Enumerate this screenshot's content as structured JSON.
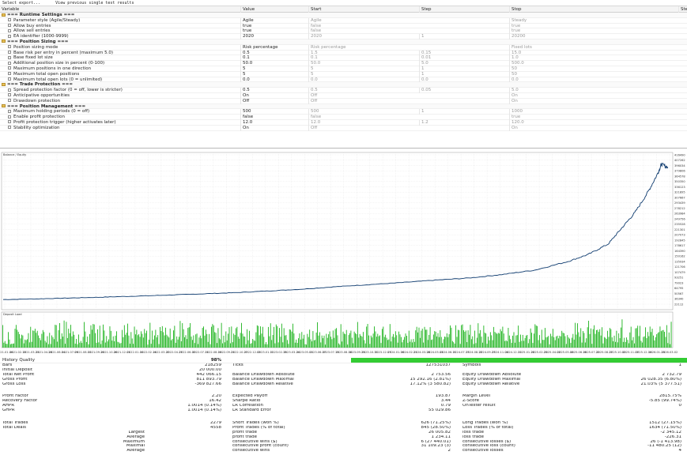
{
  "toolbar": {
    "items": [
      "Select export...",
      "View previous single test results"
    ]
  },
  "grid": {
    "headers": [
      "Variable",
      "Value",
      "Start",
      "Step",
      "Stop",
      "Steps"
    ],
    "rows": [
      {
        "group": true,
        "name": "=== Runtime Settings ===",
        "value": "",
        "start": "",
        "step": "",
        "stop": ""
      },
      {
        "group": false,
        "name": "Parameter style (Agile/Steady)",
        "value": "Agile",
        "start": "Agile",
        "step": "",
        "stop": "Steady"
      },
      {
        "group": false,
        "name": "Allow buy entries",
        "value": "true",
        "start": "false",
        "step": "",
        "stop": "true"
      },
      {
        "group": false,
        "name": "Allow sell entries",
        "value": "true",
        "start": "false",
        "step": "",
        "stop": "true"
      },
      {
        "group": false,
        "name": "EA identifier (1000-9999)",
        "value": "2020",
        "start": "2020",
        "step": "1",
        "stop": "20200"
      },
      {
        "group": true,
        "name": "=== Position Sizing ===",
        "value": "",
        "start": "",
        "step": "",
        "stop": ""
      },
      {
        "group": false,
        "name": "Position sizing mode",
        "value": "Risk percentage",
        "start": "Risk percentage",
        "step": "",
        "stop": "Fixed lots"
      },
      {
        "group": false,
        "name": "Base risk per entry in percent (maximum 5.0)",
        "value": "0.5",
        "start": "1.5",
        "step": "0.15",
        "stop": "15.0"
      },
      {
        "group": false,
        "name": "Base fixed lot size",
        "value": "0.1",
        "start": "0.1",
        "step": "0.01",
        "stop": "1.0"
      },
      {
        "group": false,
        "name": "Additional position size in percent (0-100)",
        "value": "50.0",
        "start": "50.0",
        "step": "5.0",
        "stop": "500.0"
      },
      {
        "group": false,
        "name": "Maximum positions in one direction",
        "value": "5",
        "start": "5",
        "step": "1",
        "stop": "50"
      },
      {
        "group": false,
        "name": "Maximum total open positions",
        "value": "5",
        "start": "5",
        "step": "1",
        "stop": "50"
      },
      {
        "group": false,
        "name": "Maximum total open lots (0 = unlimited)",
        "value": "0.0",
        "start": "0.0",
        "step": "0.0",
        "stop": "0.0"
      },
      {
        "group": true,
        "name": "=== Trade Protection ===",
        "value": "",
        "start": "",
        "step": "",
        "stop": ""
      },
      {
        "group": false,
        "name": "Spread protection factor (0 = off, lower is stricter)",
        "value": "0.5",
        "start": "0.5",
        "step": "0.05",
        "stop": "5.0"
      },
      {
        "group": false,
        "name": "Anticipative opportunities",
        "value": "On",
        "start": "Off",
        "step": "",
        "stop": "On"
      },
      {
        "group": false,
        "name": "Drawdown protection",
        "value": "Off",
        "start": "Off",
        "step": "",
        "stop": "On"
      },
      {
        "group": true,
        "name": "=== Position Management ===",
        "value": "",
        "start": "",
        "step": "",
        "stop": ""
      },
      {
        "group": false,
        "name": "Maximum holding periods (0 = off)",
        "value": "500",
        "start": "500",
        "step": "1",
        "stop": "1000"
      },
      {
        "group": false,
        "name": "Enable profit protection",
        "value": "false",
        "start": "false",
        "step": "",
        "stop": "true"
      },
      {
        "group": false,
        "name": "Profit protection trigger (higher activates later)",
        "value": "12.0",
        "start": "12.0",
        "step": "1.2",
        "stop": "120.0"
      },
      {
        "group": false,
        "name": "Stability optimization",
        "value": "On",
        "start": "Off",
        "step": "",
        "stop": "On"
      }
    ]
  },
  "chart_data": {
    "type": "line",
    "title": "Balance / Equity",
    "legend": [
      "Balance",
      "Equity"
    ],
    "subchart_title": "Deposit Load",
    "ylim": [
      0,
      430000
    ],
    "y_ticks": [
      "416490",
      "407262",
      "396034",
      "379806",
      "364578",
      "350350",
      "336123",
      "321895",
      "307667",
      "293439",
      "278212",
      "263984",
      "249756",
      "235528",
      "221301",
      "207073",
      "192845",
      "178617",
      "164390",
      "150162",
      "135934",
      "121706",
      "107479",
      "93251",
      "79023",
      "64795",
      "50567",
      "36340",
      "22112"
    ],
    "x_ticks": [
      "2021.01.06",
      "2021.02.12",
      "2021.03.23",
      "2021.04.28",
      "2021.06.04",
      "2021.07.09",
      "2021.08.13",
      "2021.09.20",
      "2021.10.26",
      "2021.12.01",
      "2022.01.10",
      "2022.02.14",
      "2022.03.22",
      "2022.04.27",
      "2022.06.02",
      "2022.07.11",
      "2022.08.16",
      "2022.09.21",
      "2022.10.27",
      "2022.12.02",
      "2023.01.11",
      "2023.02.15",
      "2023.03.24",
      "2023.05.01",
      "2023.06.07",
      "2023.07.13",
      "2023.08.18",
      "2023.09.25",
      "2023.10.31",
      "2023.12.07",
      "2024.01.16",
      "2024.02.21",
      "2024.03.28",
      "2024.05.03",
      "2024.06.11",
      "2024.07.17",
      "2024.08.22",
      "2024.09.27",
      "2024.11.04",
      "2024.12.11",
      "2025.01.20",
      "2025.02.25",
      "2025.04.02",
      "2025.05.08",
      "2025.06.16",
      "2025.07.22",
      "2025.08.27",
      "2025.10.02",
      "2025.11.07",
      "2025.12.16",
      "2026.01.23",
      "2026.03.02"
    ],
    "balance_points": [
      [
        0,
        20000
      ],
      [
        0.05,
        22000
      ],
      [
        0.1,
        24500
      ],
      [
        0.15,
        27000
      ],
      [
        0.2,
        30000
      ],
      [
        0.25,
        33000
      ],
      [
        0.3,
        36500
      ],
      [
        0.35,
        40000
      ],
      [
        0.4,
        45000
      ],
      [
        0.45,
        50000
      ],
      [
        0.5,
        57000
      ],
      [
        0.55,
        63000
      ],
      [
        0.6,
        69000
      ],
      [
        0.65,
        76000
      ],
      [
        0.7,
        82000
      ],
      [
        0.75,
        92000
      ],
      [
        0.8,
        105000
      ],
      [
        0.85,
        130000
      ],
      [
        0.88,
        150000
      ],
      [
        0.91,
        180000
      ],
      [
        0.93,
        225000
      ],
      [
        0.95,
        270000
      ],
      [
        0.97,
        330000
      ],
      [
        0.985,
        385000
      ],
      [
        0.99,
        410000
      ],
      [
        1.0,
        400000
      ]
    ]
  },
  "history_quality": {
    "label": "History Quality",
    "value": "98%"
  },
  "stats": {
    "rows": [
      {
        "l1": "Bars",
        "v1": "218259",
        "l2": "Ticks",
        "v2": "127531037",
        "l3": "Symbols",
        "v3": "1"
      },
      {
        "l1": "Initial Deposit",
        "v1": "20 000.00",
        "l2": "",
        "v2": "",
        "l3": "",
        "v3": ""
      },
      {
        "l1": "Total Net Profit",
        "v1": "442 066.15",
        "l2": "Balance Drawdown Absolute",
        "v2": "2 753.56",
        "l3": "Equity Drawdown Absolute",
        "v3": "2 732.79"
      },
      {
        "l1": "Gross Profit",
        "v1": "811 893.79",
        "l2": "Balance Drawdown Maximal",
        "v2": "15 292.16 (2.81%)",
        "l3": "Equity Drawdown Maximal",
        "v3": "26 028.35 (6.80%)"
      },
      {
        "l1": "Gross Loss",
        "v1": "-369 827.66",
        "l2": "Balance Drawdown Relative",
        "v2": "17.12% (3 580.82)",
        "l3": "Equity Drawdown Relative",
        "v3": "21.03% (5 377.51)"
      },
      {
        "gap": true
      },
      {
        "l1": "Profit Factor",
        "v1": "2.20",
        "l2": "Expected Payoff",
        "v2": "193.87",
        "l3": "Margin Level",
        "v3": "2815.75%"
      },
      {
        "l1": "Recovery Factor",
        "v1": "16.42",
        "l2": "Sharpe Ratio",
        "v2": "3.44",
        "l3": "Z-Score",
        "v3": "-5.85 (99.74%)"
      },
      {
        "l1": "AHPR",
        "v1": "1.0014 (0.14%)",
        "l2": "LR Correlation",
        "v2": "0.79",
        "l3": "OnTester result",
        "v3": "0"
      },
      {
        "l1": "GHPR",
        "v1": "1.0014 (0.14%)",
        "l2": "LR Standard Error",
        "v2": "55 029.86",
        "l3": "",
        "v3": ""
      },
      {
        "gap": true
      },
      {
        "l1": "Total Trades",
        "v1": "2279",
        "l2": "Short Trades (won %)",
        "v2": "626 (71.25%)",
        "l3": "Long Trades (won %)",
        "v3": "1512 (27.15%)"
      },
      {
        "l1": "Total Deals",
        "v1": "4558",
        "l2": "Profit Trades (% of total)",
        "v2": "845 (28.50%)",
        "l3": "Loss Trades (% of total)",
        "v3": "1634 (71.50%)"
      },
      {
        "l1": "Largest",
        "r1": true,
        "v1": "",
        "l2": "profit trade",
        "v2": "26 005.82",
        "l3": "loss trade",
        "v3": "-2 345.12"
      },
      {
        "l1": "Average",
        "r1": true,
        "v1": "",
        "l2": "profit trade",
        "v2": "1 234.11",
        "l3": "loss trade",
        "v3": "-226.31"
      },
      {
        "l1": "Maximum",
        "r1": true,
        "v1": "",
        "l2": "consecutive wins ($)",
        "v2": "6 (27 440.01)",
        "l3": "consecutive losses ($)",
        "v3": "26 (-1 413.98)"
      },
      {
        "l1": "Maximal",
        "r1": true,
        "v1": "",
        "l2": "consecutive profit (count)",
        "v2": "31 109.23 (3)",
        "l3": "consecutive loss (count)",
        "v3": "-11 480.25 (12)"
      },
      {
        "l1": "Average",
        "r1": true,
        "v1": "",
        "l2": "consecutive wins",
        "v2": "2",
        "l3": "consecutive losses",
        "v3": "4"
      }
    ]
  },
  "colors": {
    "balance": "#0d3a6e",
    "deposit_load": "#1cb31c",
    "grid": "#e4e4e4"
  }
}
